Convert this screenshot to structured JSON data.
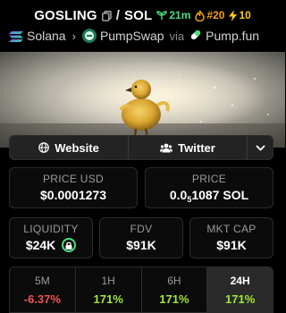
{
  "header": {
    "base_symbol": "GOSLING",
    "separator": "/",
    "quote_symbol": "SOL",
    "age": "21m",
    "rank": "#20",
    "boosts": "10"
  },
  "route": {
    "chain": "Solana",
    "dex": "PumpSwap",
    "via": "via",
    "launchpad": "Pump.fun"
  },
  "links": {
    "website": "Website",
    "twitter": "Twitter"
  },
  "price": {
    "usd_label": "PRICE USD",
    "usd_value": "$0.0001273",
    "native_label": "PRICE",
    "native_prefix": "0.0",
    "native_zeros": "5",
    "native_digits": "1087 SOL"
  },
  "stats": {
    "liquidity_label": "LIQUIDITY",
    "liquidity_value": "$24K",
    "fdv_label": "FDV",
    "fdv_value": "$91K",
    "mcap_label": "MKT CAP",
    "mcap_value": "$91K"
  },
  "timeframes": [
    {
      "label": "5M",
      "value": "-6.37%",
      "active": false
    },
    {
      "label": "1H",
      "value": "171%",
      "active": false
    },
    {
      "label": "6H",
      "value": "171%",
      "active": false
    },
    {
      "label": "24H",
      "value": "171%",
      "active": true
    }
  ],
  "colors": {
    "positive": "#a3e635",
    "negative": "#f05252",
    "age": "#4ade80",
    "rank": "#f59e0b",
    "boost": "#facc15"
  }
}
